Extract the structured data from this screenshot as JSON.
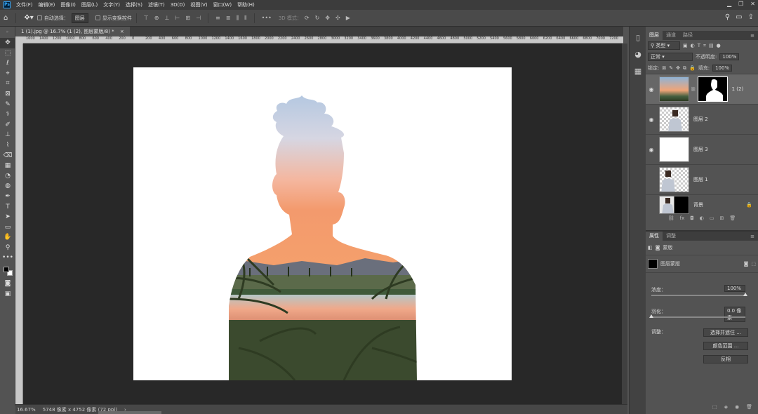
{
  "menu": {
    "logo": "Ps",
    "items": [
      "文件(F)",
      "编辑(E)",
      "图像(I)",
      "图层(L)",
      "文字(Y)",
      "选择(S)",
      "滤镜(T)",
      "3D(D)",
      "视图(V)",
      "窗口(W)",
      "帮助(H)"
    ]
  },
  "window": {
    "minimize": "▁",
    "restore": "❐",
    "close": "✕"
  },
  "options": {
    "auto_select_label": "自动选择：",
    "auto_select_value": "图层",
    "show_transform_label": "显示变换控件",
    "more": "•••",
    "mode_3d": "3D 模式："
  },
  "document": {
    "tab_title": "1 (1).jpg @ 16.7% (1 (2), 图层蒙版/8) *",
    "tab_close": "×",
    "ruler_ticks": [
      "1600",
      "1400",
      "1200",
      "1000",
      "800",
      "600",
      "400",
      "200",
      "0",
      "200",
      "400",
      "600",
      "800",
      "1000",
      "1200",
      "1400",
      "1600",
      "1800",
      "2000",
      "2200",
      "2400",
      "2600",
      "2800",
      "3000",
      "3200",
      "3400",
      "3600",
      "3800",
      "4000",
      "4200",
      "4400",
      "4600",
      "4800",
      "5000",
      "5200",
      "5400",
      "5600",
      "5800",
      "6000",
      "6200",
      "6400",
      "6600",
      "6800",
      "7000",
      "7200"
    ]
  },
  "status": {
    "zoom": "16.67%",
    "doc_size": "5748 像素 x 4752 像素 (72 ppi)"
  },
  "layers_panel": {
    "tabs": [
      "图层",
      "通道",
      "路径"
    ],
    "filter_label": "类型",
    "blend_mode": "正常",
    "opacity_label": "不透明度:",
    "opacity_value": "100%",
    "lock_label": "锁定:",
    "fill_label": "填充:",
    "fill_value": "100%",
    "layers": [
      {
        "name": "1 (2)",
        "visible": true,
        "selected": true
      },
      {
        "name": "图层 2",
        "visible": true,
        "selected": false
      },
      {
        "name": "图层 3",
        "visible": true,
        "selected": false
      },
      {
        "name": "图层 1",
        "visible": false,
        "selected": false
      },
      {
        "name": "背景",
        "visible": false,
        "selected": false
      }
    ],
    "bottom_icons": [
      "⛓",
      "fx",
      "◘",
      "◐",
      "▭",
      "⊞",
      "🗑"
    ]
  },
  "properties_panel": {
    "tabs": [
      "属性",
      "调整"
    ],
    "mask_type": "蒙版",
    "section_title": "图层蒙版",
    "density_label": "浓度：",
    "density_value": "100%",
    "density_fraction": 1.0,
    "feather_label": "羽化：",
    "feather_value": "0.0 像素",
    "feather_fraction": 0.0,
    "adjust_label": "调整：",
    "btn_select_mask": "选择并遮住 ...",
    "btn_color_range": "颜色范围 ...",
    "btn_invert": "反相"
  },
  "tools": [
    "✥",
    "⬚",
    "ℓ",
    "⌖",
    "⌗",
    "⊠",
    "✎",
    "⚕",
    "✐",
    "⊥",
    "⌇",
    "⌫",
    "▦",
    "◔",
    "◍",
    "✒",
    "T",
    "➤",
    "▭",
    "✋",
    "⚲",
    "•••"
  ],
  "colors": {
    "fg": "#000000",
    "bg": "#ffffff",
    "accent": "#31a8ff"
  }
}
